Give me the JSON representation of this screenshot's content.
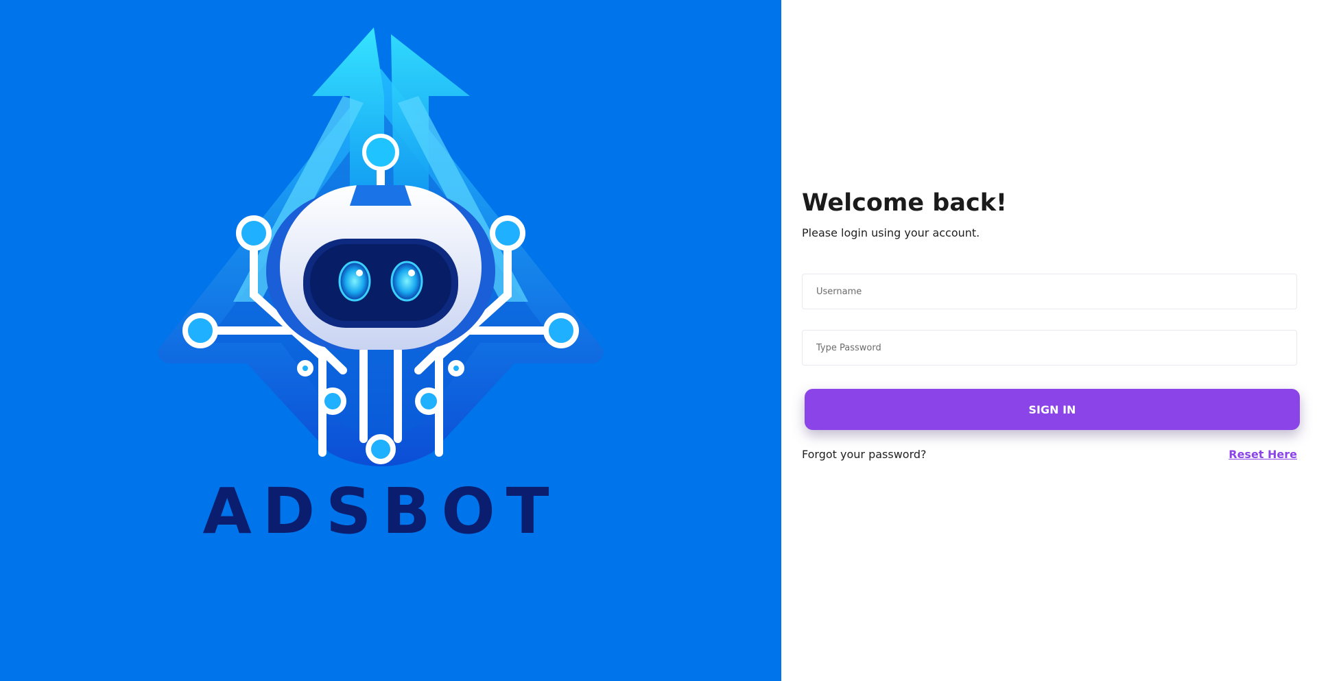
{
  "brand": {
    "name": "ADSBOT",
    "logo_icon": "robot-logo-icon",
    "panel_color": "#0074ea",
    "name_color": "#0a1d6e"
  },
  "login": {
    "title": "Welcome back!",
    "subtitle": "Please login using your account.",
    "username_placeholder": "Username",
    "username_value": "",
    "password_placeholder": "Type Password",
    "password_value": "",
    "signin_label": "SIGN IN",
    "forgot_text": "Forgot your password?",
    "reset_label": "Reset Here",
    "accent_color": "#8b44e8"
  }
}
